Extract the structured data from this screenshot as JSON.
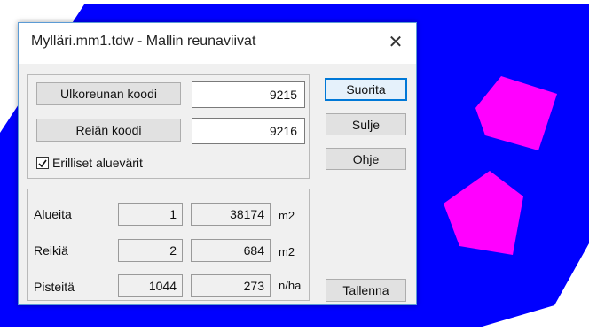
{
  "window": {
    "title": "Mylläri.mm1.tdw - Mallin reunaviivat"
  },
  "codes": {
    "outer_button": "Ulkoreunan koodi",
    "outer_value": "9215",
    "hole_button": "Reiän koodi",
    "hole_value": "9216",
    "checkbox_label": "Erilliset aluevärit",
    "checkbox_checked": true
  },
  "buttons": {
    "run": "Suorita",
    "close": "Sulje",
    "help": "Ohje",
    "save": "Tallenna"
  },
  "stats": [
    {
      "label": "Alueita",
      "count": "1",
      "value": "38174",
      "unit": "m2"
    },
    {
      "label": "Reikiä",
      "count": "2",
      "value": "684",
      "unit": "m2"
    },
    {
      "label": "Pisteitä",
      "count": "1044",
      "value": "273",
      "unit": "n/ha"
    }
  ],
  "colors": {
    "area_fill": "#0000ff",
    "hole_fill": "#ff00ff",
    "accent": "#0078d7"
  },
  "icons": {
    "close": "close-x-icon",
    "check": "checkmark-icon"
  }
}
